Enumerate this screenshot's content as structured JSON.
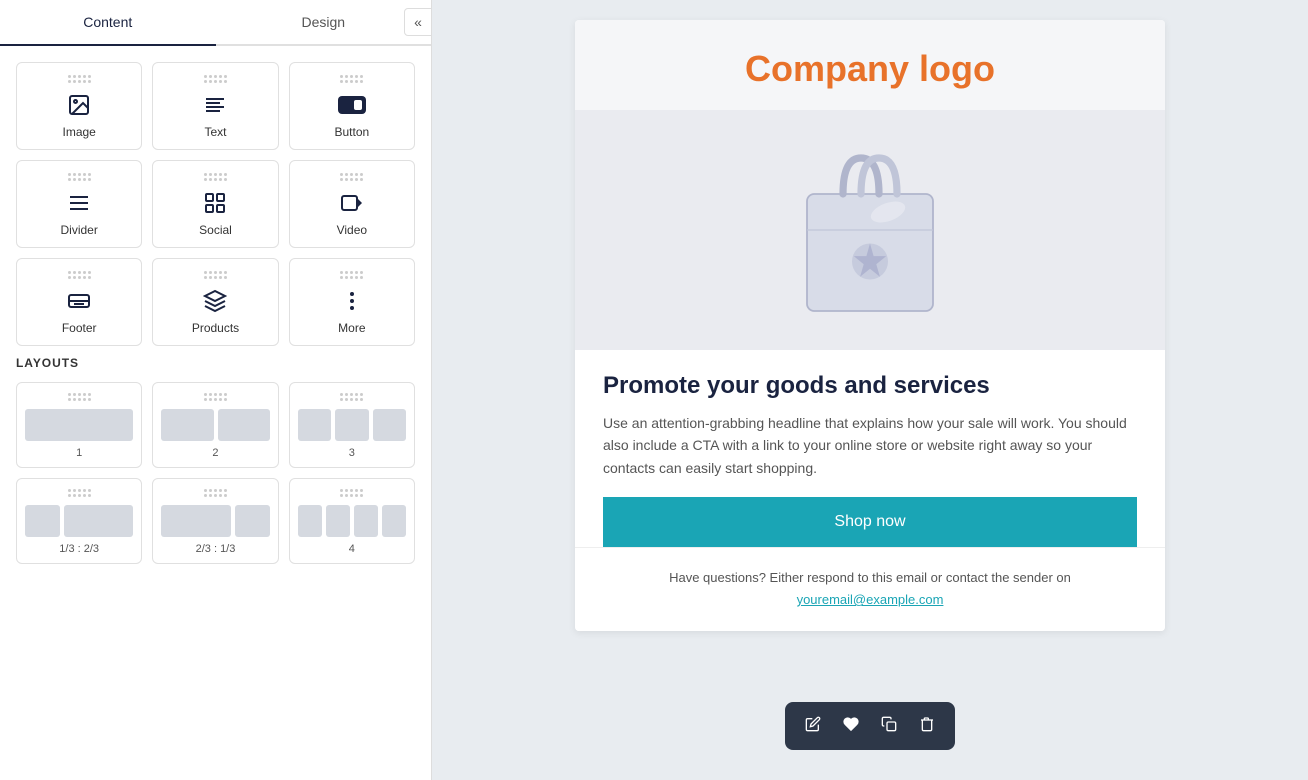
{
  "tabs": {
    "content": "Content",
    "design": "Design"
  },
  "collapse_icon": "«",
  "tiles": [
    {
      "id": "image",
      "label": "Image",
      "icon": "image"
    },
    {
      "id": "text",
      "label": "Text",
      "icon": "text"
    },
    {
      "id": "button",
      "label": "Button",
      "icon": "button"
    },
    {
      "id": "divider",
      "label": "Divider",
      "icon": "divider"
    },
    {
      "id": "social",
      "label": "Social",
      "icon": "social"
    },
    {
      "id": "video",
      "label": "Video",
      "icon": "video"
    },
    {
      "id": "footer",
      "label": "Footer",
      "icon": "footer"
    },
    {
      "id": "products",
      "label": "Products",
      "icon": "products"
    },
    {
      "id": "more",
      "label": "More",
      "icon": "more"
    }
  ],
  "layouts_label": "LAYOUTS",
  "layouts": [
    {
      "id": "1",
      "label": "1",
      "cols": [
        1
      ]
    },
    {
      "id": "2",
      "label": "2",
      "cols": [
        0.5,
        0.5
      ]
    },
    {
      "id": "3",
      "label": "3",
      "cols": [
        0.33,
        0.33,
        0.33
      ]
    },
    {
      "id": "1/3-2/3",
      "label": "1/3 : 2/3",
      "cols": [
        0.33,
        0.67
      ]
    },
    {
      "id": "2/3-1/3",
      "label": "2/3 : 1/3",
      "cols": [
        0.67,
        0.33
      ]
    },
    {
      "id": "4",
      "label": "4",
      "cols": [
        0.25,
        0.25,
        0.25,
        0.25
      ]
    }
  ],
  "email": {
    "company_logo": "Company logo",
    "product_title": "Promote your goods and services",
    "product_desc": "Use an attention-grabbing headline that explains how your sale will work. You should also include a CTA with a link to your online store or website right away so your contacts can easily start shopping.",
    "shop_btn": "Shop now",
    "footer_text": "Have questions? Either respond to this email or contact the sender on",
    "footer_email": "youremail@example.com"
  },
  "toolbar": {
    "edit": "✏",
    "heart": "♥",
    "copy": "⧉",
    "delete": "🗑"
  },
  "colors": {
    "accent_orange": "#e8722a",
    "accent_teal": "#1aa5b5",
    "dark_navy": "#1a2340"
  }
}
